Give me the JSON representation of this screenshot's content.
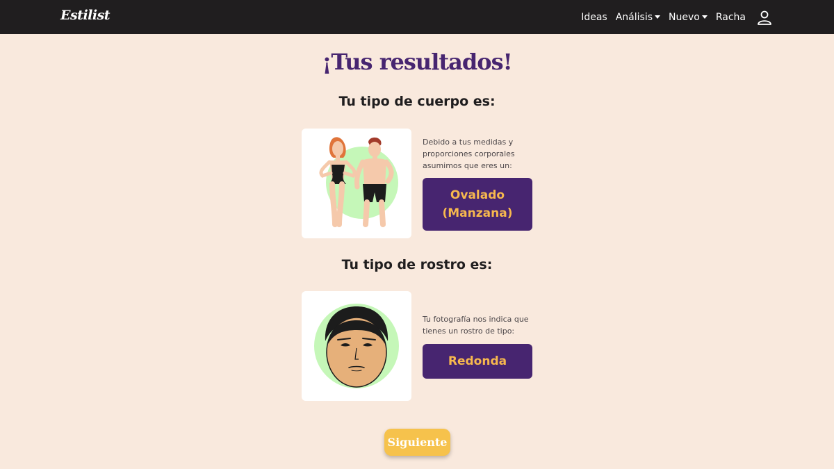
{
  "nav": {
    "brand": "Estilist",
    "items": [
      {
        "label": "Ideas",
        "dropdown": false
      },
      {
        "label": "Análisis",
        "dropdown": true
      },
      {
        "label": "Nuevo",
        "dropdown": true
      },
      {
        "label": "Racha",
        "dropdown": false
      }
    ],
    "user_icon": "user-outline-icon"
  },
  "page": {
    "title": "¡Tus resultados!"
  },
  "body_type": {
    "heading": "Tu tipo de cuerpo es:",
    "description": "Debido a tus medidas y proporciones corporales asumimos que eres un:",
    "result_line1": "Ovalado",
    "result_line2": "(Manzana)",
    "image": "body-couple-illustration"
  },
  "face_type": {
    "heading": "Tu tipo de rostro es:",
    "description": "Tu fotografía nos indica que tienes un rostro de tipo:",
    "result": "Redonda",
    "image": "round-face-illustration"
  },
  "actions": {
    "next_label": "Siguiente"
  },
  "colors": {
    "background": "#f9e9dd",
    "navbar": "#201e1f",
    "accent_purple": "#472570",
    "accent_orange": "#f7b84e",
    "button_yellow": "#f6c24c",
    "illustration_green": "#c5f7b8"
  }
}
